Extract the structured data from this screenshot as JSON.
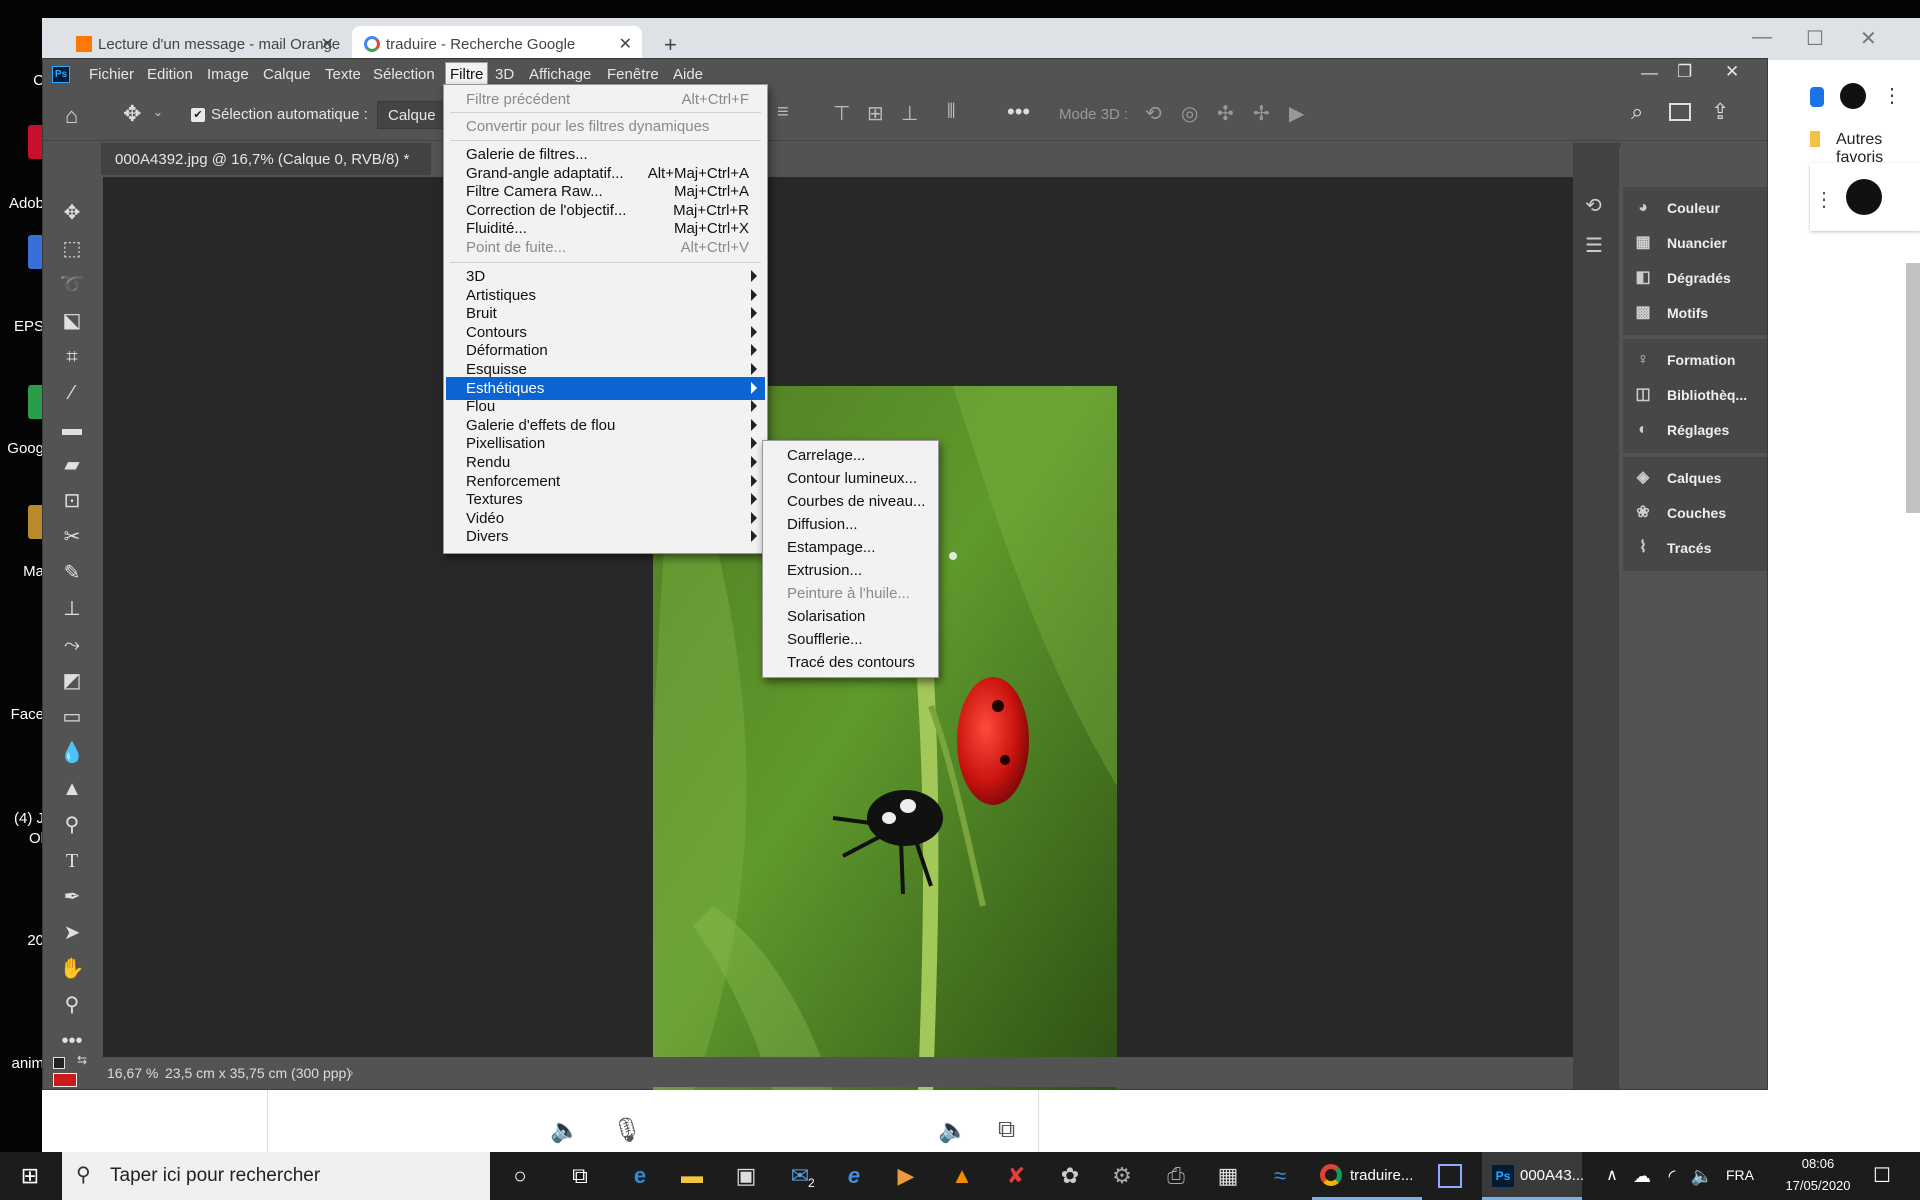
{
  "desktop": {
    "labels": [
      "C",
      "Adob",
      "EPS",
      "Goog",
      "Ma",
      "Face",
      "(4) J",
      "Ol",
      "20",
      "anim"
    ]
  },
  "chrome": {
    "tabs": [
      {
        "title": "Lecture d'un message - mail Orange",
        "active": false
      },
      {
        "title": "traduire - Recherche Google",
        "active": true
      }
    ],
    "new_tab": "+",
    "bookmarks_label": "Autres favoris",
    "win_minimize": "—",
    "win_maximize": "☐",
    "win_close": "✕"
  },
  "photoshop": {
    "logo": "Ps",
    "menus": [
      "Fichier",
      "Edition",
      "Image",
      "Calque",
      "Texte",
      "Sélection",
      "Filtre",
      "3D",
      "Affichage",
      "Fenêtre",
      "Aide"
    ],
    "active_menu": "Filtre",
    "options": {
      "auto_select_label": "Sélection automatique :",
      "auto_select_checked": true,
      "auto_select_value": "Calque",
      "mode3d_label": "Mode 3D :"
    },
    "document_tab": "000A4392.jpg @ 16,7% (Calque 0, RVB/8) *",
    "document_tab_close": "×",
    "status": {
      "zoom": "16,67 %",
      "doc_size": "23,5 cm x 35,75 cm (300 ppp)",
      "arrow": "›"
    },
    "panels_group1": [
      "Couleur",
      "Nuancier",
      "Dégradés",
      "Motifs"
    ],
    "panels_group2": [
      "Formation",
      "Bibliothèq...",
      "Réglages"
    ],
    "panels_group3": [
      "Calques",
      "Couches",
      "Tracés"
    ],
    "window_controls": {
      "minimize": "—",
      "restore": "❐",
      "close": "✕"
    },
    "foreground_color": "#cc1a1a"
  },
  "filter_menu": {
    "items": [
      {
        "label": "Filtre précédent",
        "shortcut": "Alt+Ctrl+F",
        "disabled": true
      },
      {
        "label": "Convertir pour les filtres dynamiques",
        "shortcut": "",
        "disabled": true
      },
      {
        "label": "Galerie de filtres...",
        "shortcut": ""
      },
      {
        "label": "Grand-angle adaptatif...",
        "shortcut": "Alt+Maj+Ctrl+A"
      },
      {
        "label": "Filtre Camera Raw...",
        "shortcut": "Maj+Ctrl+A"
      },
      {
        "label": "Correction de l'objectif...",
        "shortcut": "Maj+Ctrl+R"
      },
      {
        "label": "Fluidité...",
        "shortcut": "Maj+Ctrl+X"
      },
      {
        "label": "Point de fuite...",
        "shortcut": "Alt+Ctrl+V",
        "disabled": true
      },
      {
        "label": "3D",
        "submenu": true
      },
      {
        "label": "Artistiques",
        "submenu": true
      },
      {
        "label": "Bruit",
        "submenu": true
      },
      {
        "label": "Contours",
        "submenu": true
      },
      {
        "label": "Déformation",
        "submenu": true
      },
      {
        "label": "Esquisse",
        "submenu": true
      },
      {
        "label": "Esthétiques",
        "submenu": true,
        "highlighted": true
      },
      {
        "label": "Flou",
        "submenu": true
      },
      {
        "label": "Galerie d'effets de flou",
        "submenu": true
      },
      {
        "label": "Pixellisation",
        "submenu": true
      },
      {
        "label": "Rendu",
        "submenu": true
      },
      {
        "label": "Renforcement",
        "submenu": true
      },
      {
        "label": "Textures",
        "submenu": true
      },
      {
        "label": "Vidéo",
        "submenu": true
      },
      {
        "label": "Divers",
        "submenu": true
      }
    ]
  },
  "stylize_submenu": {
    "items": [
      {
        "label": "Carrelage..."
      },
      {
        "label": "Contour lumineux..."
      },
      {
        "label": "Courbes de niveau..."
      },
      {
        "label": "Diffusion..."
      },
      {
        "label": "Estampage..."
      },
      {
        "label": "Extrusion..."
      },
      {
        "label": "Peinture à l'huile...",
        "disabled": true
      },
      {
        "label": "Solarisation"
      },
      {
        "label": "Soufflerie..."
      },
      {
        "label": "Tracé des contours"
      }
    ]
  },
  "taskbar": {
    "search_placeholder": "Taper ici pour rechercher",
    "apps": [
      {
        "label": "traduire..."
      },
      {
        "label": "000A43..."
      }
    ],
    "mail_badge": "2",
    "language": "FRA",
    "time": "08:06",
    "date": "17/05/2020"
  }
}
